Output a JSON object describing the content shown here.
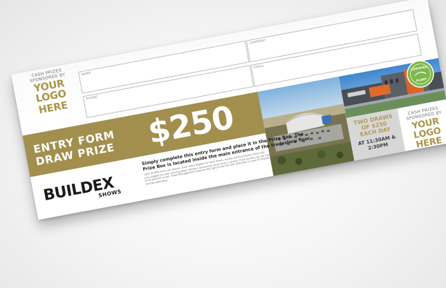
{
  "left_sponsor": {
    "caption_line1": "CASH PRIZES",
    "caption_line2": "SPONSORED BY",
    "logo_line1": "YOUR LOGO",
    "logo_line2": "HERE"
  },
  "form": {
    "name_label": "NAME",
    "company_label": "COMPANY",
    "phone_label": "PHONE",
    "email_label": "EMAIL"
  },
  "banner": {
    "line1": "ENTRY FORM",
    "line2": "DRAW PRIZE",
    "amount": "$250"
  },
  "badge": {
    "line1": "CERTIFIED",
    "line2": "PLANT"
  },
  "draws": {
    "line1": "TWO DRAWS",
    "line2": "OF $250",
    "line3": "EACH DAY",
    "time_line1": "AT 11:30AM &",
    "time_line2": "2:30PM"
  },
  "right_sponsor": {
    "caption_line1": "CASH PRIZES",
    "caption_line2": "SPONSORED BY",
    "logo_line1": "YOUR LOGO",
    "logo_line2": "HERE"
  },
  "brand": {
    "name": "BUILDEX",
    "sub": "SHOWS"
  },
  "instructions": {
    "bold_line1": "Simply complete this entry form and place it in the Prize Box. The",
    "bold_line2": "Prize Box is located inside the main entrance of the tradeshow floor.",
    "fine_line1": "Limit of ONE entry per person. Each entry eligible for both draws, except winning tickets which are",
    "fine_line2": "only eligible for their winning draw. Winners announced when prize is drawn. Prize winners do not need",
    "fine_line3": "to be present to win. Show Management reserves the right to be the sole arbitrator in case of dispute",
    "fine_line4": "of prize allocation."
  },
  "colors": {
    "gold": "#a28f4e",
    "sponsor_gold": "#a89545",
    "grey_box": "#d7d7d7",
    "badge_green": "#7fb84a"
  }
}
